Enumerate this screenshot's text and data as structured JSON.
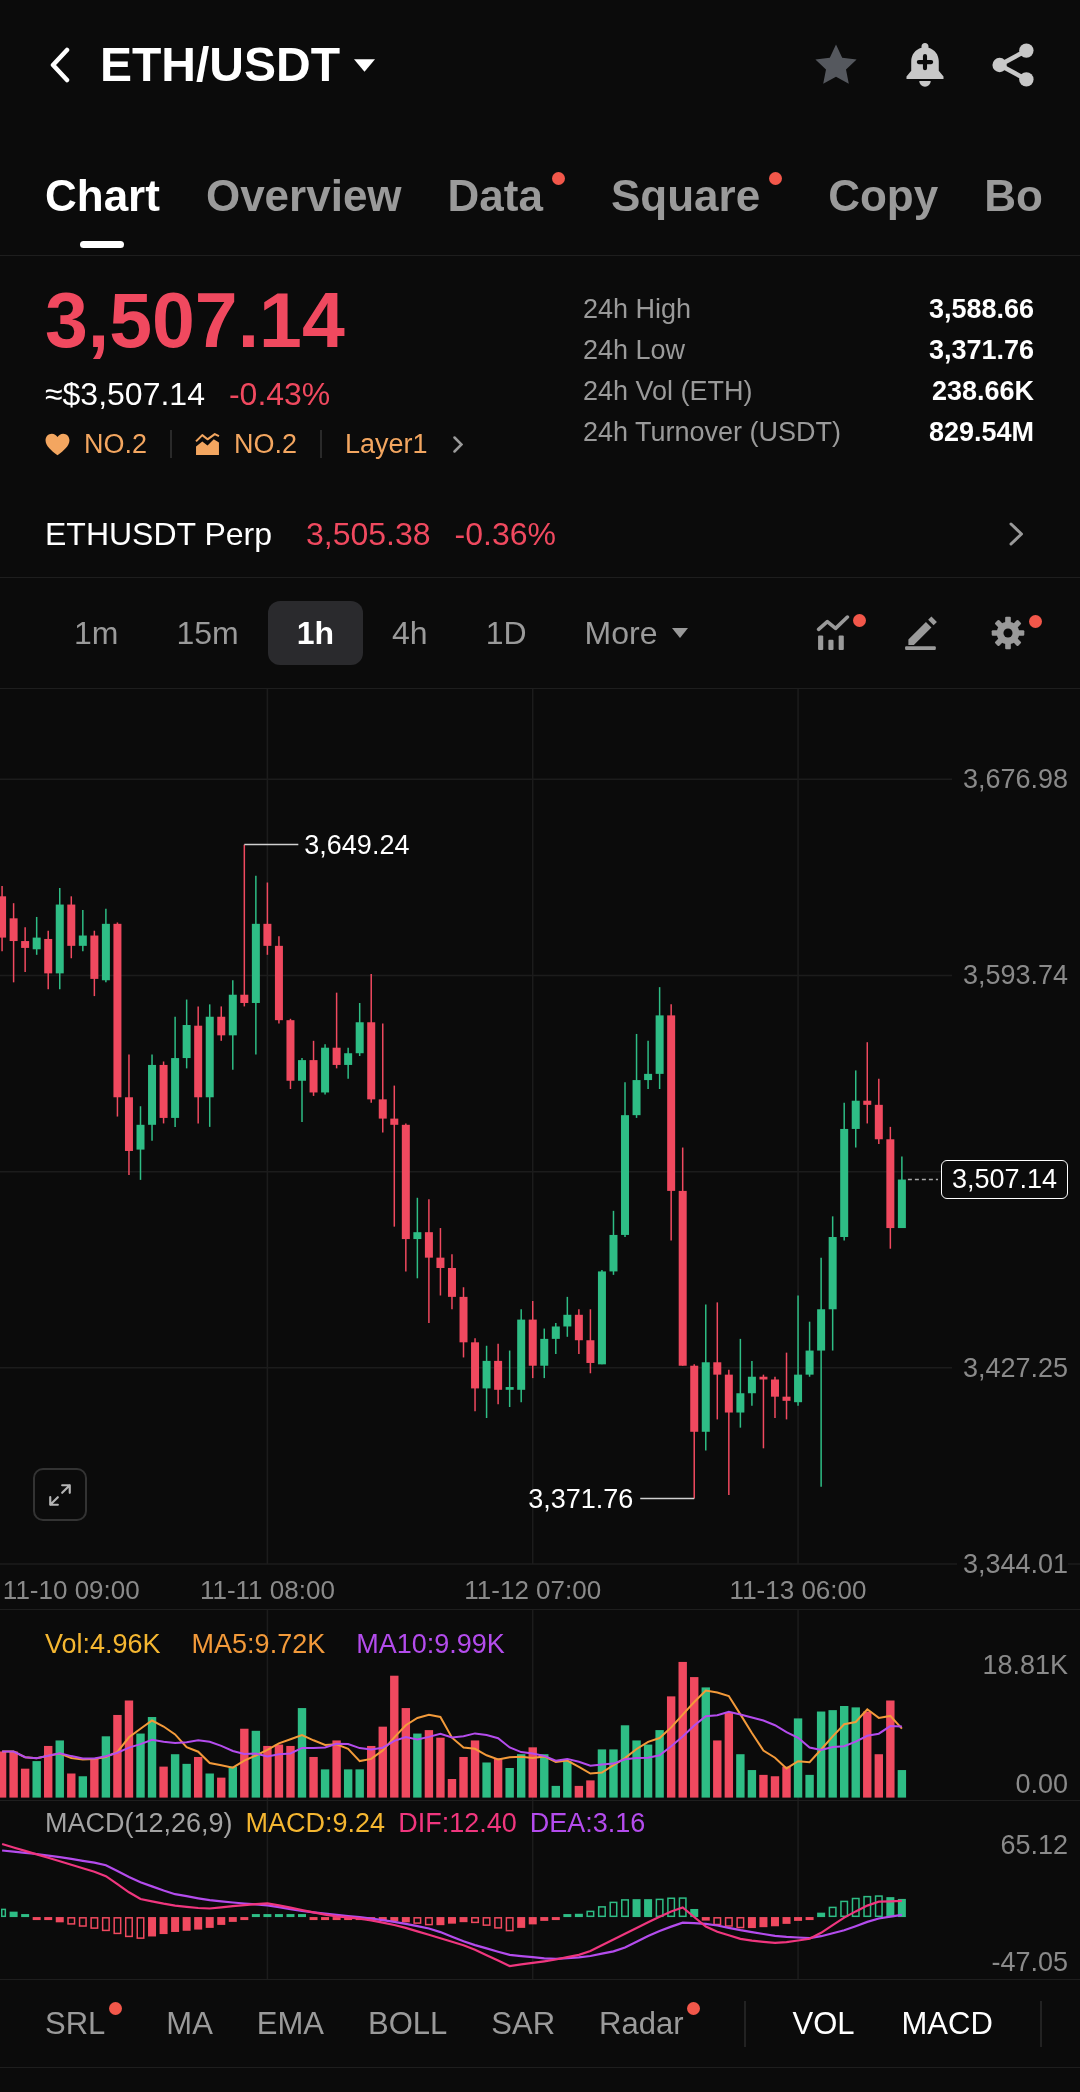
{
  "header": {
    "title": "ETH/USDT"
  },
  "tabs": [
    {
      "label": "Chart",
      "selected": true,
      "dot": false
    },
    {
      "label": "Overview",
      "selected": false,
      "dot": false
    },
    {
      "label": "Data",
      "selected": false,
      "dot": true
    },
    {
      "label": "Square",
      "selected": false,
      "dot": true
    },
    {
      "label": "Copy",
      "selected": false,
      "dot": false
    },
    {
      "label": "Bo",
      "selected": false,
      "dot": false
    }
  ],
  "price": {
    "last": "3,507.14",
    "fiat": "≈$3,507.14",
    "change": "-0.43%",
    "tags": [
      {
        "kind": "heart",
        "label": "NO.2"
      },
      {
        "kind": "trend",
        "label": "NO.2"
      },
      {
        "kind": "sector",
        "label": "Layer1"
      }
    ]
  },
  "stats": [
    {
      "label": "24h High",
      "value": "3,588.66"
    },
    {
      "label": "24h Low",
      "value": "3,371.76"
    },
    {
      "label": "24h Vol (ETH)",
      "value": "238.66K"
    },
    {
      "label": "24h Turnover (USDT)",
      "value": "829.54M"
    }
  ],
  "perp": {
    "name": "ETHUSDT Perp",
    "price": "3,505.38",
    "change": "-0.36%"
  },
  "intervals": [
    {
      "label": "1m",
      "selected": false,
      "kind": "interval"
    },
    {
      "label": "15m",
      "selected": false,
      "kind": "interval"
    },
    {
      "label": "1h",
      "selected": true,
      "kind": "interval"
    },
    {
      "label": "4h",
      "selected": false,
      "kind": "interval"
    },
    {
      "label": "1D",
      "selected": false,
      "kind": "interval"
    },
    {
      "label": "More",
      "selected": false,
      "kind": "menu"
    }
  ],
  "tools": [
    {
      "kind": "indicators",
      "dot": true
    },
    {
      "kind": "draw",
      "dot": false
    },
    {
      "kind": "settings",
      "dot": true
    }
  ],
  "chart": {
    "chart_data": {
      "type": "candlestick",
      "categories": [
        null,
        null,
        null,
        null,
        null,
        null,
        "11-10 09:00",
        null,
        null,
        null,
        null,
        null,
        null,
        null,
        null,
        null,
        null,
        null,
        null,
        null,
        null,
        null,
        null,
        "11-11 08:00",
        null,
        null,
        null,
        null,
        null,
        null,
        null,
        null,
        null,
        null,
        null,
        null,
        null,
        null,
        null,
        null,
        null,
        null,
        null,
        null,
        null,
        null,
        "11-12 07:00",
        null,
        null,
        null,
        null,
        null,
        null,
        null,
        null,
        null,
        null,
        null,
        null,
        null,
        null,
        null,
        null,
        null,
        null,
        null,
        null,
        null,
        null,
        "11-13 06:00",
        null,
        null,
        null,
        null,
        null,
        null,
        null,
        null,
        null
      ],
      "ohlc": [
        [
          3627.31,
          3631.69,
          3603.95,
          3609.79
        ],
        [
          3617.97,
          3624.39,
          3590.81,
          3608.33
        ],
        [
          3608.33,
          3614.17,
          3595.19,
          3605.41
        ],
        [
          3604.83,
          3618.55,
          3602.49,
          3609.79
        ],
        [
          3609.21,
          3612.71,
          3587.89,
          3594.61
        ],
        [
          3594.61,
          3630.82,
          3587.89,
          3623.81
        ],
        [
          3623.81,
          3627.31,
          3601.03,
          3606.29
        ],
        [
          3606.29,
          3621.47,
          3603.95,
          3610.67
        ],
        [
          3610.67,
          3612.71,
          3584.97,
          3592.27
        ],
        [
          3591.69,
          3622.06,
          3590.81,
          3615.63
        ],
        [
          3615.63,
          3616.22,
          3533.86,
          3542.04
        ],
        [
          3542.04,
          3560.15,
          3509.04,
          3519.26
        ],
        [
          3519.84,
          3538.24,
          3506.99,
          3530.36
        ],
        [
          3530.36,
          3560.15,
          3523.64,
          3555.76
        ],
        [
          3555.76,
          3557.22,
          3530.94,
          3533.28
        ],
        [
          3533.28,
          3576.21,
          3529.48,
          3558.68
        ],
        [
          3558.68,
          3583.51,
          3554.3,
          3572.7
        ],
        [
          3572.41,
          3580.59,
          3530.94,
          3542.04
        ],
        [
          3542.04,
          3581.46,
          3529.48,
          3576.21
        ],
        [
          3576.21,
          3580.59,
          3565.99,
          3568.32
        ],
        [
          3568.32,
          3591.69,
          3553.72,
          3585.55
        ],
        [
          3585.55,
          3649.24,
          3580.59,
          3582.05
        ],
        [
          3582.05,
          3636.08,
          3560.15,
          3615.63
        ],
        [
          3615.63,
          3633.16,
          3602.49,
          3606.29
        ],
        [
          3606.29,
          3610.38,
          3573.29,
          3574.75
        ],
        [
          3574.75,
          3575.33,
          3545.54,
          3549.05
        ],
        [
          3549.05,
          3558.68,
          3531.53,
          3557.81
        ],
        [
          3557.81,
          3565.99,
          3542.62,
          3544.08
        ],
        [
          3544.08,
          3564.53,
          3543.21,
          3563.07
        ],
        [
          3563.07,
          3586.43,
          3554.3,
          3555.76
        ],
        [
          3555.76,
          3563.07,
          3549.92,
          3560.73
        ],
        [
          3560.73,
          3582.05,
          3559.56,
          3573.87
        ],
        [
          3573.87,
          3594.31,
          3539.7,
          3541.16
        ],
        [
          3541.16,
          3573.29,
          3527.14,
          3532.99
        ],
        [
          3532.99,
          3547.0,
          3487.14,
          3530.36
        ],
        [
          3530.36,
          3530.94,
          3468.15,
          3481.88
        ],
        [
          3481.88,
          3499.4,
          3465.23,
          3484.8
        ],
        [
          3484.8,
          3498.82,
          3446.25,
          3473.99
        ],
        [
          3473.99,
          3486.55,
          3457.93,
          3469.61
        ],
        [
          3469.61,
          3475.45,
          3452.09,
          3457.35
        ],
        [
          3457.35,
          3461.44,
          3431.65,
          3438.07
        ],
        [
          3438.07,
          3439.82,
          3408.87,
          3418.51
        ],
        [
          3418.51,
          3436.61,
          3405.95,
          3430.19
        ],
        [
          3430.19,
          3437.49,
          3411.79,
          3417.92
        ],
        [
          3417.92,
          3434.57,
          3410.62,
          3419.09
        ],
        [
          3417.92,
          3452.09,
          3412.66,
          3447.71
        ],
        [
          3447.71,
          3455.59,
          3422.89,
          3428.14
        ],
        [
          3428.14,
          3443.91,
          3422.89,
          3439.53
        ],
        [
          3439.53,
          3446.25,
          3433.11,
          3444.79
        ],
        [
          3444.79,
          3457.35,
          3440.41,
          3449.75
        ],
        [
          3449.75,
          3452.09,
          3433.11,
          3438.95
        ],
        [
          3438.95,
          3452.09,
          3424.93,
          3429.31
        ],
        [
          3428.73,
          3468.74,
          3428.73,
          3468.15
        ],
        [
          3468.15,
          3493.85,
          3466.69,
          3483.63
        ],
        [
          3483.63,
          3548.46,
          3482.75,
          3534.45
        ],
        [
          3534.45,
          3568.91,
          3533.28,
          3549.34
        ],
        [
          3549.34,
          3565.99,
          3545.54,
          3551.97
        ],
        [
          3551.97,
          3588.77,
          3545.54,
          3576.79
        ],
        [
          3576.79,
          3581.46,
          3481.29,
          3502.32
        ],
        [
          3502.32,
          3520.72,
          3428.14,
          3428.14
        ],
        [
          3428.14,
          3428.73,
          3371.76,
          3400.11
        ],
        [
          3400.11,
          3454.13,
          3392.22,
          3429.6
        ],
        [
          3429.6,
          3455.01,
          3405.36,
          3424.35
        ],
        [
          3424.35,
          3426.39,
          3373.24,
          3408.28
        ],
        [
          3408.28,
          3439.53,
          3401.86,
          3416.46
        ],
        [
          3416.46,
          3430.19,
          3411.2,
          3423.47
        ],
        [
          3423.47,
          3424.35,
          3393.1,
          3422.3
        ],
        [
          3422.3,
          3423.47,
          3405.95,
          3415.0
        ],
        [
          3415.0,
          3433.69,
          3405.36,
          3413.25
        ],
        [
          3412.66,
          3457.93,
          3411.2,
          3424.35
        ],
        [
          3424.35,
          3446.83,
          3423.47,
          3434.57
        ],
        [
          3434.57,
          3473.99,
          3376.74,
          3452.09
        ],
        [
          3452.09,
          3491.52,
          3434.57,
          3482.75
        ],
        [
          3482.75,
          3539.7,
          3481.29,
          3528.6
        ],
        [
          3528.6,
          3553.43,
          3520.72,
          3540.58
        ],
        [
          3540.58,
          3565.4,
          3530.94,
          3538.83
        ],
        [
          3538.83,
          3549.92,
          3522.18,
          3524.22
        ],
        [
          3524.22,
          3529.48,
          3477.79,
          3486.55
        ],
        [
          3486.55,
          3516.92,
          3486.55,
          3507.14
        ]
      ],
      "ylim": [
        3344.01,
        3715.27
      ],
      "yticks": [
        {
          "value": 3676.98,
          "label": "3,676.98"
        },
        {
          "value": 3593.74,
          "label": "3,593.74"
        },
        {
          "value": 3427.25,
          "label": "3,427.25"
        },
        {
          "value": 3344.01,
          "label": "3,344.01"
        }
      ],
      "grid": true,
      "annotations": [
        "3,649.24",
        "3,371.76",
        "3,507.14"
      ]
    }
  },
  "volume": {
    "legend": [
      {
        "label": "Vol:4.96K",
        "color": "#f5b731"
      },
      {
        "label": "MA5:9.72K",
        "color": "#f39a3a"
      },
      {
        "label": "MA10:9.99K",
        "color": "#b44ced"
      }
    ],
    "y_labels": [
      "18.81K",
      "0.00"
    ]
  },
  "macd": {
    "legend": [
      {
        "label": "MACD(12,26,9)",
        "color": "#a3a3a3"
      },
      {
        "label": "MACD:9.24",
        "color": "#f5b731"
      },
      {
        "label": "DIF:12.40",
        "color": "#f0367e"
      },
      {
        "label": "DEA:3.16",
        "color": "#b44ced"
      }
    ],
    "y_labels": [
      "65.12",
      "-47.05"
    ]
  },
  "main_indicators": [
    {
      "label": "SRL",
      "selected": false,
      "dot": true
    },
    {
      "label": "MA",
      "selected": false,
      "dot": false
    },
    {
      "label": "EMA",
      "selected": false,
      "dot": false
    },
    {
      "label": "BOLL",
      "selected": false,
      "dot": false
    },
    {
      "label": "SAR",
      "selected": false,
      "dot": false
    },
    {
      "label": "Radar",
      "selected": false,
      "dot": true
    }
  ],
  "sub_indicators": [
    {
      "label": "VOL",
      "selected": true
    },
    {
      "label": "MACD",
      "selected": true
    }
  ]
}
